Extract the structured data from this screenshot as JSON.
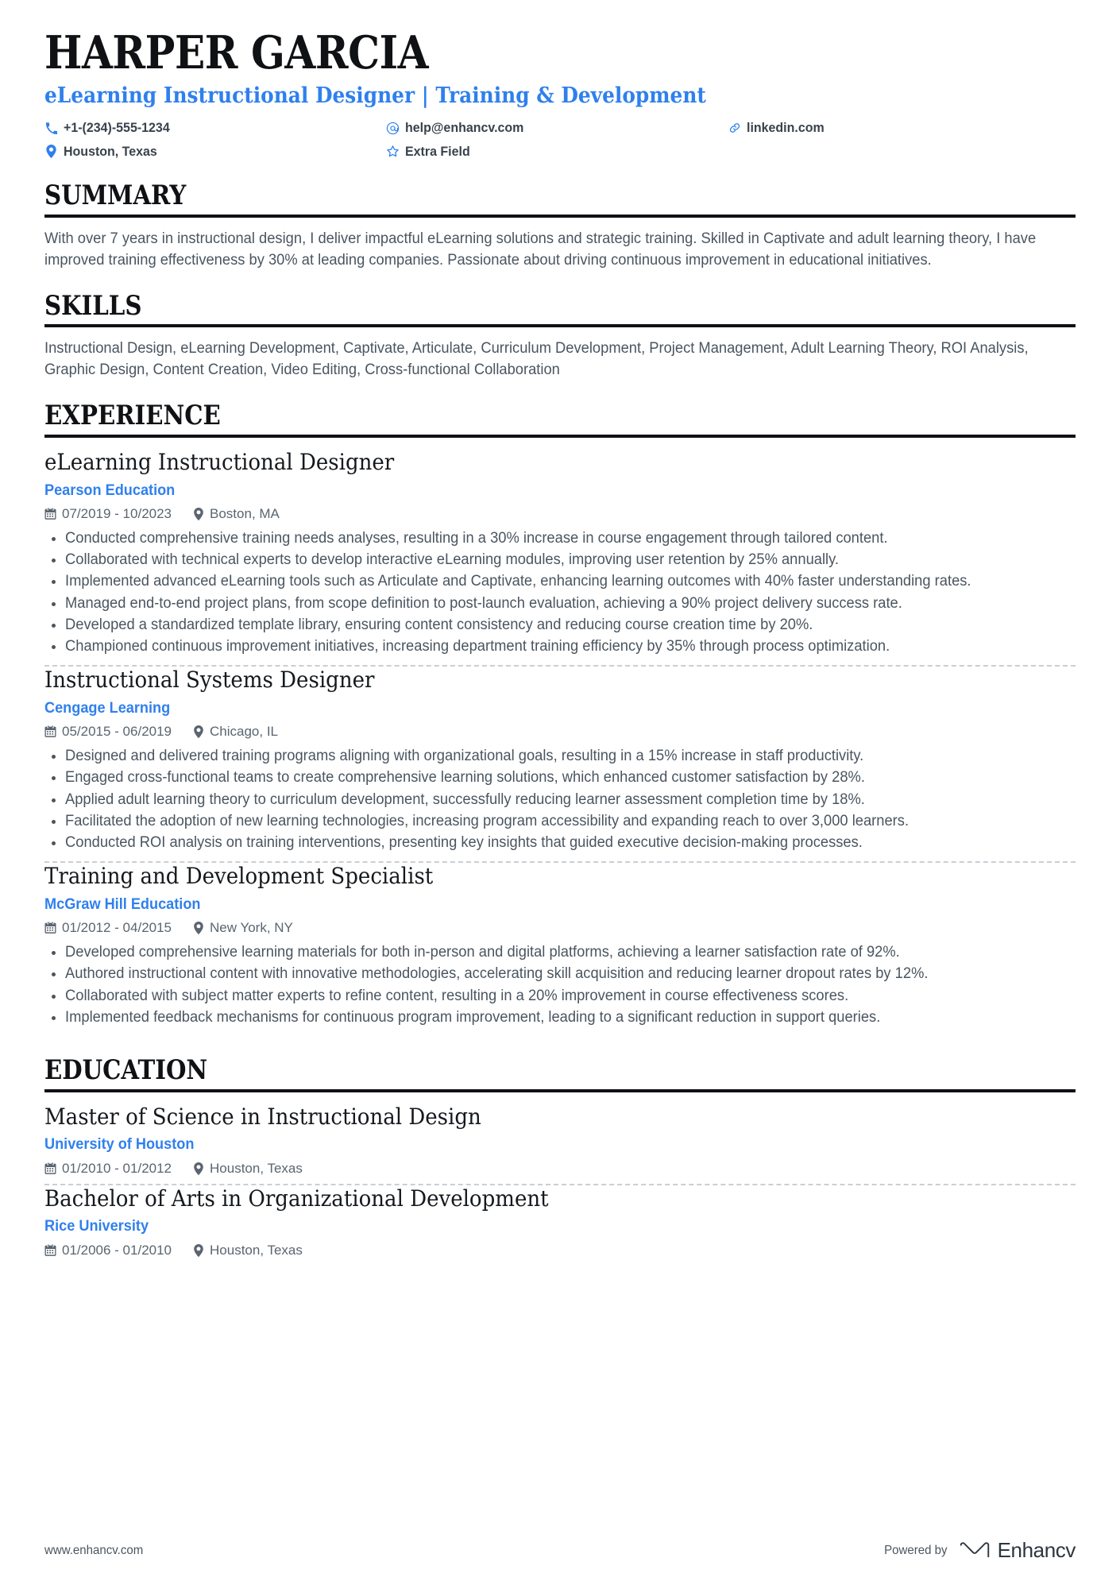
{
  "header": {
    "name": "HARPER GARCIA",
    "headline": "eLearning Instructional Designer | Training & Development",
    "contacts": [
      {
        "icon": "phone-icon",
        "text": "+1-(234)-555-1234"
      },
      {
        "icon": "email-icon",
        "text": "help@enhancv.com"
      },
      {
        "icon": "link-icon",
        "text": "linkedin.com"
      },
      {
        "icon": "location-icon",
        "text": "Houston, Texas"
      },
      {
        "icon": "star-icon",
        "text": "Extra Field"
      }
    ]
  },
  "colors": {
    "accent_blue": "#2f80ed",
    "heading_black": "#0f1114",
    "body_gray": "#4a5560",
    "separator_gray": "#c9cfd5"
  },
  "sections": {
    "summary": {
      "title": "SUMMARY",
      "text": "With over 7 years in instructional design, I deliver impactful eLearning solutions and strategic training. Skilled in Captivate and adult learning theory, I have improved training effectiveness by 30% at leading companies. Passionate about driving continuous improvement in educational initiatives."
    },
    "skills": {
      "title": "SKILLS",
      "text": "Instructional Design, eLearning Development, Captivate, Articulate, Curriculum Development, Project Management, Adult Learning Theory, ROI Analysis, Graphic Design, Content Creation, Video Editing, Cross-functional Collaboration"
    },
    "experience": {
      "title": "EXPERIENCE",
      "entries": [
        {
          "title": "eLearning Instructional Designer",
          "org": "Pearson Education",
          "dates": "07/2019 - 10/2023",
          "location": "Boston, MA",
          "bullets": [
            "Conducted comprehensive training needs analyses, resulting in a 30% increase in course engagement through tailored content.",
            "Collaborated with technical experts to develop interactive eLearning modules, improving user retention by 25% annually.",
            "Implemented advanced eLearning tools such as Articulate and Captivate, enhancing learning outcomes with 40% faster understanding rates.",
            "Managed end-to-end project plans, from scope definition to post-launch evaluation, achieving a 90% project delivery success rate.",
            "Developed a standardized template library, ensuring content consistency and reducing course creation time by 20%.",
            "Championed continuous improvement initiatives, increasing department training efficiency by 35% through process optimization."
          ]
        },
        {
          "title": "Instructional Systems Designer",
          "org": "Cengage Learning",
          "dates": "05/2015 - 06/2019",
          "location": "Chicago, IL",
          "bullets": [
            "Designed and delivered training programs aligning with organizational goals, resulting in a 15% increase in staff productivity.",
            "Engaged cross-functional teams to create comprehensive learning solutions, which enhanced customer satisfaction by 28%.",
            "Applied adult learning theory to curriculum development, successfully reducing learner assessment completion time by 18%.",
            "Facilitated the adoption of new learning technologies, increasing program accessibility and expanding reach to over 3,000 learners.",
            "Conducted ROI analysis on training interventions, presenting key insights that guided executive decision-making processes."
          ]
        },
        {
          "title": "Training and Development Specialist",
          "org": "McGraw Hill Education",
          "dates": "01/2012 - 04/2015",
          "location": "New York, NY",
          "bullets": [
            "Developed comprehensive learning materials for both in-person and digital platforms, achieving a learner satisfaction rate of 92%.",
            "Authored instructional content with innovative methodologies, accelerating skill acquisition and reducing learner dropout rates by 12%.",
            "Collaborated with subject matter experts to refine content, resulting in a 20% improvement in course effectiveness scores.",
            "Implemented feedback mechanisms for continuous program improvement, leading to a significant reduction in support queries."
          ]
        }
      ]
    },
    "education": {
      "title": "EDUCATION",
      "entries": [
        {
          "title": "Master of Science in Instructional Design",
          "org": "University of Houston",
          "dates": "01/2010 - 01/2012",
          "location": "Houston, Texas"
        },
        {
          "title": "Bachelor of Arts in Organizational Development",
          "org": "Rice University",
          "dates": "01/2006 - 01/2010",
          "location": "Houston, Texas"
        }
      ]
    }
  },
  "footer": {
    "url": "www.enhancv.com",
    "powered_by": "Powered by",
    "brand": "Enhancv"
  }
}
